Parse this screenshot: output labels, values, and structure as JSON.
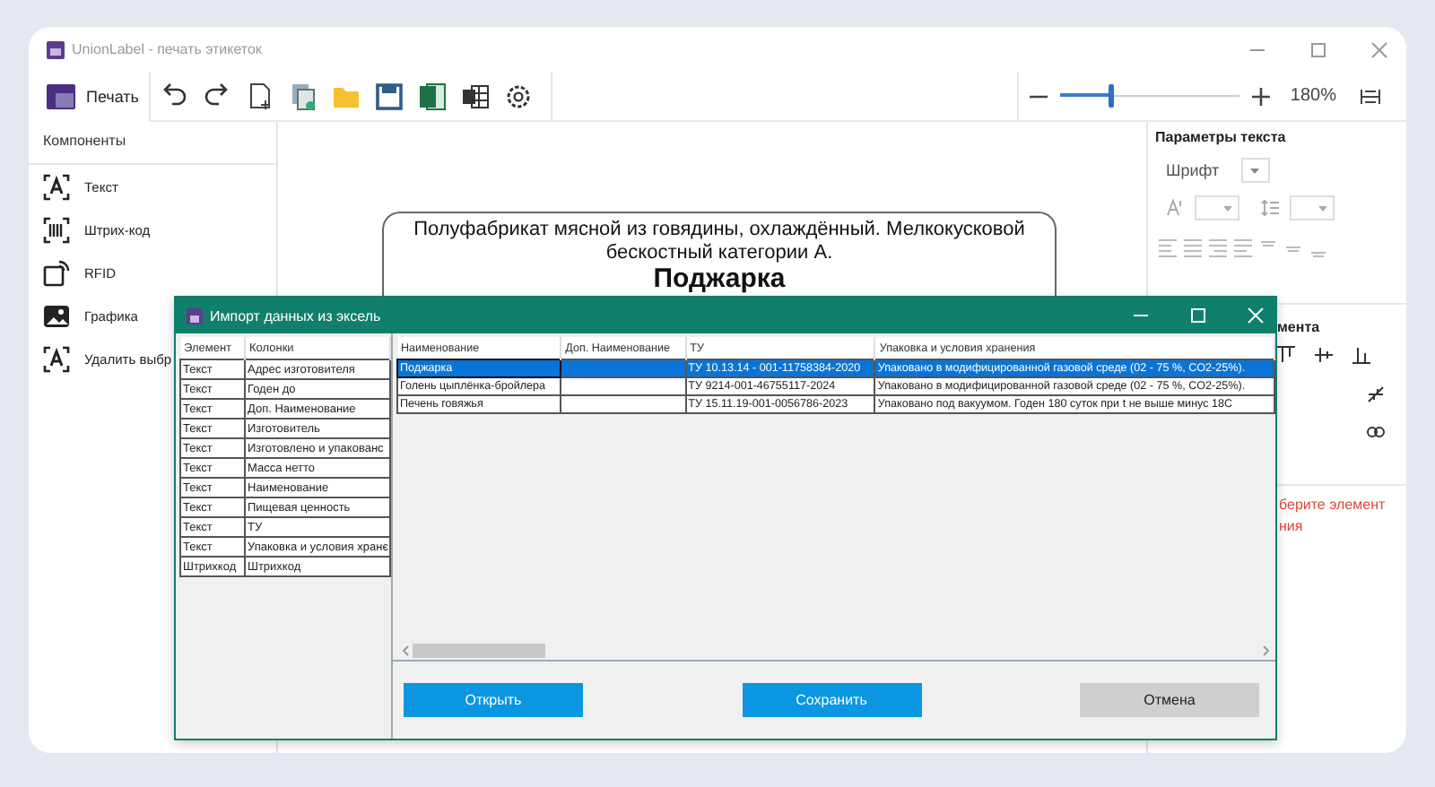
{
  "window": {
    "title": "UnionLabel - печать этикеток"
  },
  "toolbar": {
    "print_label": "Печать"
  },
  "zoom": {
    "level": 0.28,
    "value": "180%"
  },
  "components": {
    "title": "Компоненты",
    "items": [
      {
        "label": "Текст",
        "kind": "text"
      },
      {
        "label": "Штрих-код",
        "kind": "barcode"
      },
      {
        "label": "RFID",
        "kind": "rfid"
      },
      {
        "label": "Графика",
        "kind": "image"
      },
      {
        "label": "Удалить выбр",
        "kind": "text"
      }
    ]
  },
  "label_preview": {
    "lines": [
      "Полуфабрикат мясной из говядины, охлаждённый. Мелкокусковой",
      "бескостный категории А."
    ],
    "title": "Поджарка"
  },
  "text_params": {
    "title": "Параметры текста",
    "font_label": "Шрифт"
  },
  "element_params": {
    "title": "мента",
    "hint_lines": [
      "берите элемент",
      "ния"
    ]
  },
  "dialog": {
    "title": "Импорт данных из эксель",
    "mapping": {
      "columns": [
        "Элемент",
        "Колонки"
      ],
      "rows": [
        [
          "Текст",
          "Адрес изготовителя"
        ],
        [
          "Текст",
          "Годен до"
        ],
        [
          "Текст",
          "Доп. Наименование"
        ],
        [
          "Текст",
          "Изготовитель"
        ],
        [
          "Текст",
          "Изготовлено и упакованс"
        ],
        [
          "Текст",
          "Масса нетто"
        ],
        [
          "Текст",
          "Наименование"
        ],
        [
          "Текст",
          "Пищевая ценность"
        ],
        [
          "Текст",
          "ТУ"
        ],
        [
          "Текст",
          "Упаковка и условия хранє"
        ],
        [
          "Штрихкод",
          "Штрихкод"
        ]
      ]
    },
    "data": {
      "columns": [
        "Наименование",
        "Доп. Наименование",
        "ТУ",
        "Упаковка и условия хранения"
      ],
      "rows": [
        {
          "name": "Поджарка",
          "tu": "ТУ 10.13.14 - 001-11758384-2020",
          "storage": "Упаковано в модифицированной газовой среде (02 - 75 %, CO2-25%).",
          "selected": true
        },
        {
          "name": "Голень цыплёнка-бройлера",
          "tu": "ТУ 9214-001-46755117-2024",
          "storage": "Упаковано в модифицированной газовой среде (02 - 75 %, CO2-25%).",
          "selected": false
        },
        {
          "name": "Печень говяжья",
          "tu": "ТУ 15.11.19-001-0056786-2023",
          "storage": "Упаковано под вакуумом. Годен 180 суток при t не выше минус 18С",
          "selected": false
        }
      ]
    },
    "buttons": [
      {
        "label": "Открыть",
        "kind": "primary"
      },
      {
        "label": "Сохранить",
        "kind": "primary"
      },
      {
        "label": "Отмена",
        "kind": "secondary"
      }
    ]
  }
}
